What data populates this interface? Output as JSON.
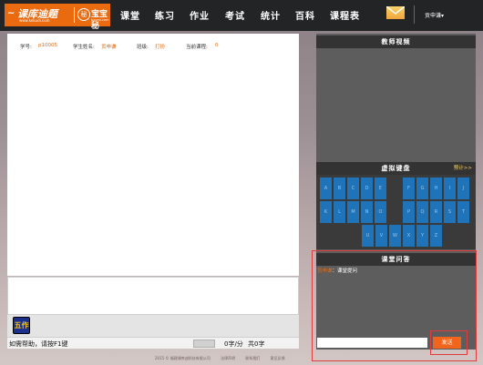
{
  "logo": {
    "brand1": "课库迪题",
    "brand1_sub": "www.kekudi.com",
    "brand2": "宝宝秘",
    "brand2_mark": "秘",
    "brand2_sub": "baomi.com"
  },
  "nav": [
    "课堂",
    "练习",
    "作业",
    "考试",
    "统计",
    "百科",
    "课程表"
  ],
  "user": {
    "name": "贡申谦▾"
  },
  "student_info": {
    "id_label": "学号:",
    "id_value": "p10005",
    "name_label": "学生姓名:",
    "name_value": "贡申谦",
    "class_label": "班级:",
    "class_value": "打扮",
    "course_label": "当前课程:",
    "course_value": "0"
  },
  "tool": {
    "wubi_label": "五作"
  },
  "status": {
    "help": "如需帮助，请按F1键",
    "speed": "0字/分",
    "count": "共0字"
  },
  "footer": [
    "2015 ©  福建课库迪科技有限公司",
    "法律声明",
    "联系我们",
    "意见反馈"
  ],
  "teacher_video": {
    "title": "教师视频"
  },
  "keyboard": {
    "title": "虚拟键盘",
    "more": "预计>>",
    "rows": [
      [
        "A",
        "B",
        "C",
        "D",
        "E",
        "F",
        "G",
        "H",
        "I",
        "J"
      ],
      [
        "K",
        "L",
        "M",
        "N",
        "O",
        "P",
        "Q",
        "R",
        "S",
        "T"
      ],
      [
        "U",
        "V",
        "W",
        "X",
        "Y",
        "Z"
      ]
    ]
  },
  "qa": {
    "title": "课堂问答",
    "sender": "贡申谦",
    "message": "：课堂提问",
    "input_value": "",
    "send_label": "发送"
  },
  "colors": {
    "accent": "#f0641c",
    "topbar": "#232426",
    "key": "#1e73b9",
    "highlight": "#e23b3b"
  }
}
